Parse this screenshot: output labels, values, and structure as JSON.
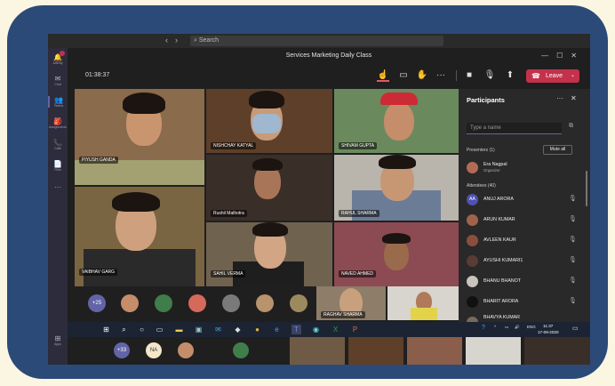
{
  "search": {
    "placeholder": "Search"
  },
  "nav": {
    "back": "‹",
    "forward": "›"
  },
  "window": {
    "title": "Services Marketing Daily Class",
    "minimize": "—",
    "maximize": "☐",
    "close": "✕"
  },
  "rail": {
    "items": [
      {
        "icon": "bell-icon",
        "glyph": "🔔",
        "label": "Activity"
      },
      {
        "icon": "chat-icon",
        "glyph": "✉",
        "label": "Chat"
      },
      {
        "icon": "teams-icon",
        "glyph": "👥",
        "label": "Teams"
      },
      {
        "icon": "assignments-icon",
        "glyph": "🎒",
        "label": "Assignments"
      },
      {
        "icon": "calls-icon",
        "glyph": "📞",
        "label": "Calls"
      },
      {
        "icon": "files-icon",
        "glyph": "📄",
        "label": "Files"
      },
      {
        "icon": "more-icon",
        "glyph": "···",
        "label": ""
      },
      {
        "icon": "apps-icon",
        "glyph": "⊞",
        "label": "Apps"
      }
    ]
  },
  "meeting": {
    "timer": "01:38:37",
    "leave_label": "Leave",
    "phone_glyph": "☎",
    "dropdown_glyph": "⌄"
  },
  "toolbar_icons": [
    {
      "name": "participants-icon",
      "glyph": "☝"
    },
    {
      "name": "chat-icon",
      "glyph": "▭"
    },
    {
      "name": "raise-hand-icon",
      "glyph": "✋"
    },
    {
      "name": "more-actions-icon",
      "glyph": "···"
    },
    {
      "name": "camera-icon",
      "glyph": "■"
    },
    {
      "name": "mic-icon",
      "glyph": "🎙"
    },
    {
      "name": "share-screen-icon",
      "glyph": "⬆"
    }
  ],
  "tiles": [
    {
      "name": "PIYUSH GANDA"
    },
    {
      "name": "NISHCHAY KATYAL"
    },
    {
      "name": "SHIVAM GUPTA"
    },
    {
      "name": "Rushil Malhotra"
    },
    {
      "name": "RAHUL SHARMA"
    },
    {
      "name": "VAIBHAV GARG"
    },
    {
      "name": "SAHIL VERMA"
    },
    {
      "name": "NAVED AHMED"
    },
    {
      "name": "RAGHAV SHARMA"
    }
  ],
  "strip": {
    "overflow_count": "+25"
  },
  "participants": {
    "title": "Participants",
    "more_glyph": "···",
    "close_glyph": "✕",
    "search_placeholder": "Type a name",
    "share_glyph": "⧉",
    "presenters_label": "Presenters (1)",
    "mute_all_label": "Mute all",
    "organizer": {
      "name": "Era Nagpal",
      "role": "Organizer"
    },
    "attendees_label": "Attendees (40)",
    "attendees": [
      {
        "name": "ANUJ ARORA",
        "initials": "AA"
      },
      {
        "name": "ARUN KUMAR",
        "initials": ""
      },
      {
        "name": "AVLEEN KAUR",
        "initials": ""
      },
      {
        "name": "AYUSHI KUMARI1",
        "initials": ""
      },
      {
        "name": "BHANU BHANOT",
        "initials": ""
      },
      {
        "name": "BHARIT ARORA",
        "initials": ""
      },
      {
        "name": "BHAVYA KUMAR",
        "initials": ""
      }
    ],
    "mic_glyph": "🎙"
  },
  "taskbar": {
    "search_glyph": "⌕",
    "language": "ENG",
    "time": "11:37",
    "date": "17-09-2020",
    "chevron": "^",
    "volume": "🔊",
    "notification": "▭"
  },
  "bottom_strip": {
    "overflow_count": "+33",
    "initials": "NA"
  }
}
